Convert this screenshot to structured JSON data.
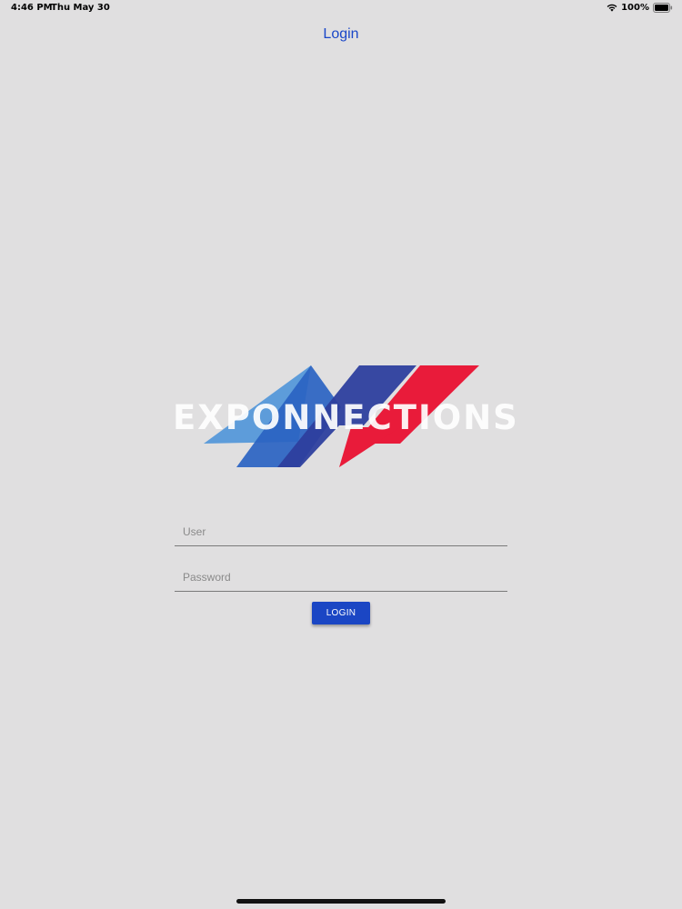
{
  "status_bar": {
    "time": "4:46 PM",
    "date": "Thu May 30",
    "battery_percent": "100%",
    "battery_level": 1.0
  },
  "nav": {
    "title": "Login"
  },
  "logo": {
    "text": "EXPONNECTIONS",
    "colors": {
      "light_blue": "#4f95d9",
      "mid_blue": "#2a63c2",
      "dark_blue": "#2d3f9e",
      "red": "#e91b3a"
    }
  },
  "form": {
    "user_placeholder": "User",
    "user_value": "",
    "password_placeholder": "Password",
    "password_value": "",
    "login_label": "LOGIN"
  },
  "theme": {
    "background": "#e0dfe0",
    "accent": "#1b46c4"
  }
}
